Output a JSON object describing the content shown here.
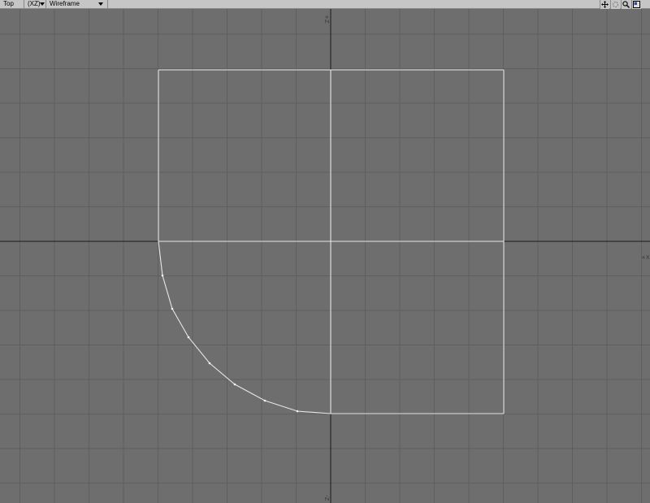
{
  "toolbar": {
    "view_label": "Top",
    "axis_label": "(XZ)",
    "render_mode_label": "Wireframe",
    "buttons": [
      {
        "name": "pan-move-icon"
      },
      {
        "name": "rotate-icon"
      },
      {
        "name": "zoom-icon"
      },
      {
        "name": "maximize-viewport-icon"
      }
    ]
  },
  "viewport": {
    "axis_labels": {
      "top": "+Z",
      "right": "+X",
      "bottom": "-Z"
    }
  },
  "colors": {
    "background": "#6e6e6e",
    "grid": "#5f5f5f",
    "axis": "#1a1a1a",
    "wire": "#e6e6e6",
    "toolbar": "#c6c6c6"
  }
}
